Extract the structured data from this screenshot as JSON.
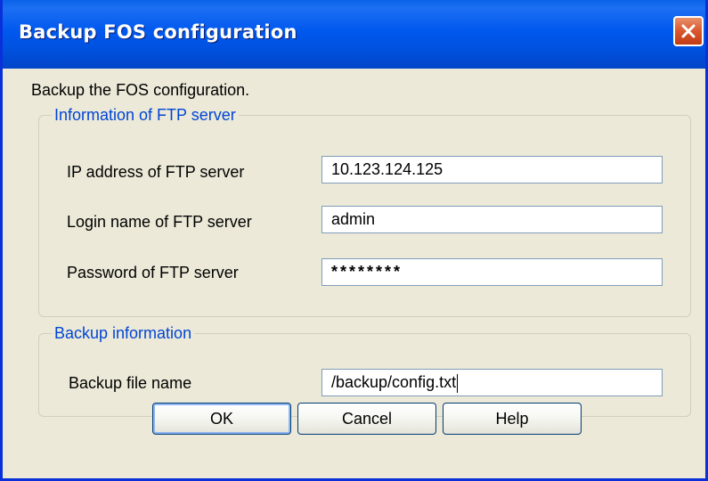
{
  "dialog": {
    "title": "Backup FOS configuration",
    "description": "Backup the FOS configuration."
  },
  "ftp_group": {
    "legend": "Information of FTP server",
    "ip_label": "IP address of FTP server",
    "ip_value": "10.123.124.125",
    "login_label": "Login name of FTP server",
    "login_value": "admin",
    "password_label": "Password of FTP server",
    "password_value": "********"
  },
  "backup_group": {
    "legend": "Backup information",
    "file_label": "Backup file name",
    "file_value": "/backup/config.txt"
  },
  "buttons": {
    "ok": "OK",
    "cancel": "Cancel",
    "help": "Help"
  },
  "colors": {
    "titlebar": "#0058ee",
    "legend_text": "#0046d5",
    "close_button": "#d9572f",
    "dialog_bg": "#ece9d8"
  },
  "icons": {
    "close": "close-icon"
  }
}
